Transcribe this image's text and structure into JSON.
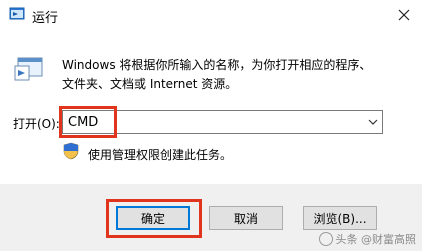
{
  "window": {
    "title": "运行",
    "icon": "run-icon",
    "close_icon": "close-icon"
  },
  "description": {
    "line1": "Windows 将根据你所输入的名称，为你打开相应的程序、",
    "line2": "文件夹、文档或 Internet 资源。",
    "icon": "run-app-icon"
  },
  "open_field": {
    "label": "打开(O):",
    "value": "CMD"
  },
  "admin_note": {
    "text": "使用管理权限创建此任务。",
    "icon": "shield-icon"
  },
  "buttons": {
    "ok": "确定",
    "cancel": "取消",
    "browse": "浏览(B)..."
  },
  "watermark": {
    "text": "头条 @财富高照"
  },
  "colors": {
    "highlight": "#e0341c",
    "accent": "#0078d7"
  }
}
